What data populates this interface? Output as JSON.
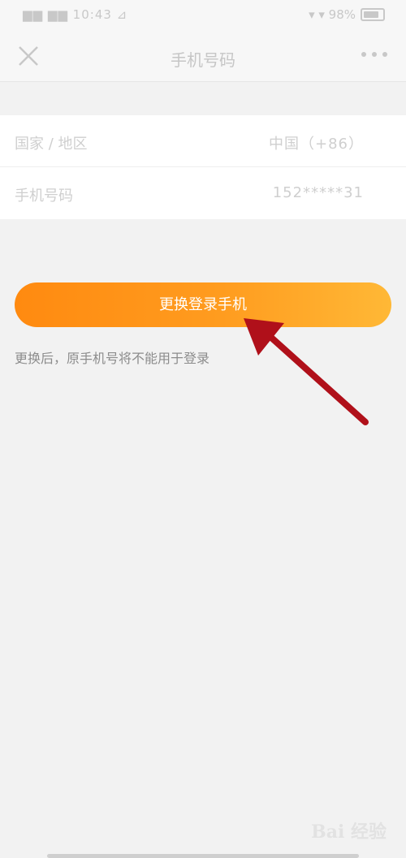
{
  "status": {
    "left": "▆▆ ▆▆ 10:43 ⊿",
    "right": "▾ ▾ 98%"
  },
  "nav": {
    "title": "手机号码"
  },
  "rows": [
    {
      "label": "国家 / 地区",
      "value": "中国（+86）"
    },
    {
      "label": "手机号码",
      "value": "152*****31"
    }
  ],
  "button": {
    "label": "更换登录手机"
  },
  "hint": "更换后，原手机号将不能用于登录",
  "watermark": "Bai 经验",
  "colors": {
    "accent_start": "#ff8a10",
    "accent_end": "#ffb836",
    "annotation_arrow": "#b0101a"
  }
}
